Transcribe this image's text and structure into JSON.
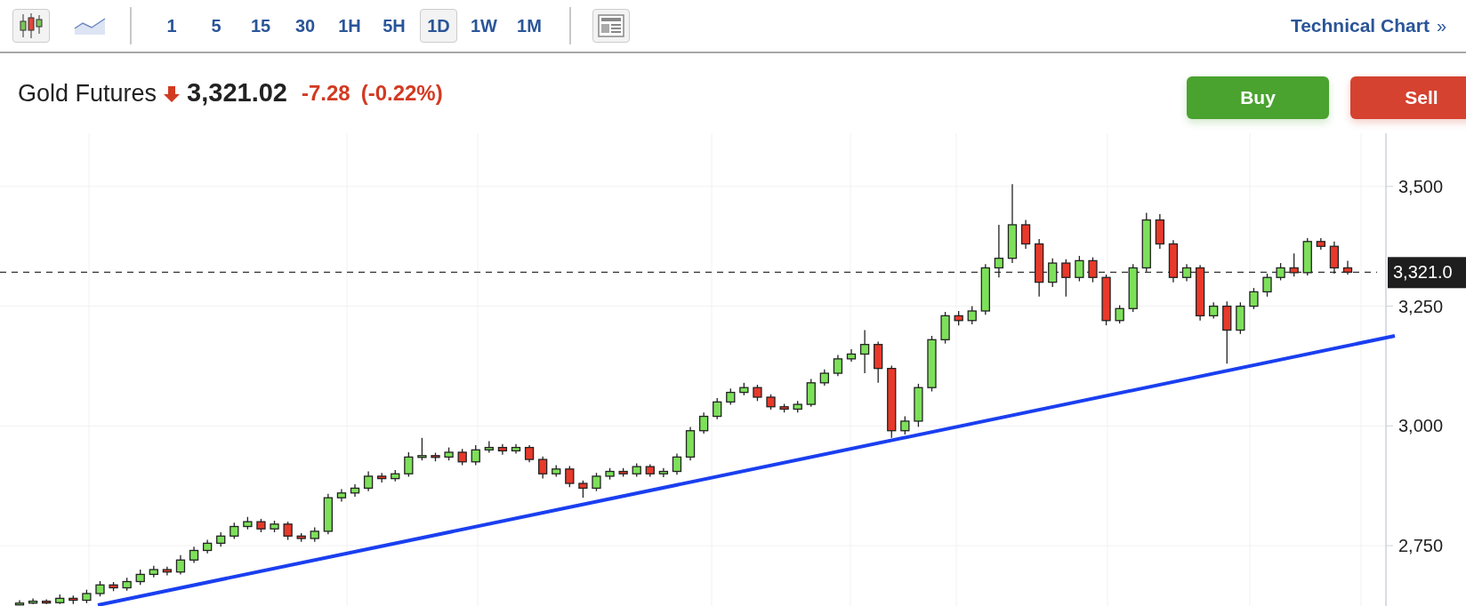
{
  "toolbar": {
    "chart_types": [
      {
        "kind": "candlestick",
        "selected": true
      },
      {
        "kind": "line",
        "selected": false
      }
    ],
    "intervals": [
      {
        "label": "1",
        "selected": false
      },
      {
        "label": "5",
        "selected": false
      },
      {
        "label": "15",
        "selected": false
      },
      {
        "label": "30",
        "selected": false
      },
      {
        "label": "1H",
        "selected": false
      },
      {
        "label": "5H",
        "selected": false
      },
      {
        "label": "1D",
        "selected": true
      },
      {
        "label": "1W",
        "selected": false
      },
      {
        "label": "1M",
        "selected": false
      }
    ],
    "technical_chart_link": "Technical Chart",
    "link_arrow": "»"
  },
  "quote": {
    "name": "Gold Futures",
    "falling": true,
    "price": "3,321.02",
    "change": "-7.28",
    "change_percent": "(-0.22%)"
  },
  "actions": [
    {
      "kind": "buy",
      "label": "Buy"
    },
    {
      "kind": "sell",
      "label": "Sell"
    }
  ],
  "chart": {
    "chart_data": {
      "type": "candlestick",
      "grid": true,
      "ylim": [
        2624,
        3611
      ],
      "ref_lines": [
        {
          "axis": "y",
          "value": 3321.02,
          "label": "3,321.0"
        }
      ],
      "yticks": [
        {
          "value": 3500,
          "label": "3,500"
        },
        {
          "value": 3250,
          "label": "3,250"
        },
        {
          "value": 3000,
          "label": "3,000"
        },
        {
          "value": 2750,
          "label": "2,750"
        }
      ],
      "ohlc": [
        [
          2628,
          2636,
          2627,
          2630
        ],
        [
          2630,
          2640,
          2628,
          2634
        ],
        [
          2634,
          2638,
          2628,
          2631
        ],
        [
          2631,
          2648,
          2628,
          2640
        ],
        [
          2640,
          2646,
          2628,
          2636
        ],
        [
          2636,
          2658,
          2630,
          2650
        ],
        [
          2650,
          2676,
          2644,
          2668
        ],
        [
          2668,
          2674,
          2655,
          2662
        ],
        [
          2662,
          2683,
          2656,
          2675
        ],
        [
          2675,
          2700,
          2668,
          2690
        ],
        [
          2690,
          2708,
          2684,
          2700
        ],
        [
          2700,
          2706,
          2688,
          2695
        ],
        [
          2695,
          2730,
          2690,
          2720
        ],
        [
          2720,
          2748,
          2714,
          2740
        ],
        [
          2740,
          2762,
          2734,
          2755
        ],
        [
          2755,
          2778,
          2748,
          2770
        ],
        [
          2770,
          2798,
          2764,
          2790
        ],
        [
          2790,
          2810,
          2784,
          2800
        ],
        [
          2800,
          2806,
          2778,
          2785
        ],
        [
          2785,
          2802,
          2778,
          2795
        ],
        [
          2795,
          2800,
          2762,
          2770
        ],
        [
          2770,
          2776,
          2758,
          2765
        ],
        [
          2765,
          2788,
          2758,
          2780
        ],
        [
          2780,
          2858,
          2774,
          2850
        ],
        [
          2850,
          2868,
          2842,
          2860
        ],
        [
          2860,
          2878,
          2852,
          2870
        ],
        [
          2870,
          2905,
          2864,
          2895
        ],
        [
          2895,
          2902,
          2882,
          2890
        ],
        [
          2890,
          2908,
          2884,
          2900
        ],
        [
          2900,
          2945,
          2894,
          2935
        ],
        [
          2935,
          2975,
          2928,
          2938
        ],
        [
          2938,
          2944,
          2926,
          2935
        ],
        [
          2935,
          2955,
          2928,
          2945
        ],
        [
          2945,
          2952,
          2918,
          2925
        ],
        [
          2925,
          2960,
          2918,
          2950
        ],
        [
          2950,
          2968,
          2944,
          2955
        ],
        [
          2955,
          2962,
          2940,
          2948
        ],
        [
          2948,
          2962,
          2942,
          2955
        ],
        [
          2955,
          2960,
          2924,
          2930
        ],
        [
          2930,
          2936,
          2890,
          2900
        ],
        [
          2900,
          2918,
          2894,
          2910
        ],
        [
          2910,
          2916,
          2872,
          2880
        ],
        [
          2880,
          2886,
          2850,
          2870
        ],
        [
          2870,
          2902,
          2864,
          2895
        ],
        [
          2895,
          2912,
          2888,
          2905
        ],
        [
          2905,
          2912,
          2894,
          2900
        ],
        [
          2900,
          2922,
          2894,
          2915
        ],
        [
          2915,
          2920,
          2894,
          2900
        ],
        [
          2900,
          2912,
          2893,
          2905
        ],
        [
          2905,
          2942,
          2898,
          2935
        ],
        [
          2935,
          2998,
          2928,
          2990
        ],
        [
          2990,
          3028,
          2984,
          3020
        ],
        [
          3020,
          3058,
          3014,
          3050
        ],
        [
          3050,
          3078,
          3044,
          3070
        ],
        [
          3070,
          3090,
          3064,
          3080
        ],
        [
          3080,
          3086,
          3052,
          3060
        ],
        [
          3060,
          3066,
          3034,
          3040
        ],
        [
          3040,
          3046,
          3028,
          3035
        ],
        [
          3035,
          3052,
          3028,
          3045
        ],
        [
          3045,
          3098,
          3040,
          3090
        ],
        [
          3090,
          3118,
          3084,
          3110
        ],
        [
          3110,
          3148,
          3104,
          3140
        ],
        [
          3140,
          3160,
          3134,
          3150
        ],
        [
          3150,
          3200,
          3110,
          3170
        ],
        [
          3170,
          3176,
          3090,
          3120
        ],
        [
          3120,
          3126,
          2975,
          2990
        ],
        [
          2990,
          3020,
          2982,
          3010
        ],
        [
          3010,
          3088,
          2998,
          3080
        ],
        [
          3080,
          3188,
          3072,
          3180
        ],
        [
          3180,
          3238,
          3172,
          3230
        ],
        [
          3230,
          3240,
          3210,
          3220
        ],
        [
          3220,
          3250,
          3212,
          3240
        ],
        [
          3240,
          3338,
          3232,
          3330
        ],
        [
          3330,
          3420,
          3310,
          3350
        ],
        [
          3350,
          3505,
          3340,
          3420
        ],
        [
          3420,
          3430,
          3370,
          3380
        ],
        [
          3380,
          3390,
          3270,
          3300
        ],
        [
          3300,
          3350,
          3290,
          3340
        ],
        [
          3340,
          3348,
          3270,
          3310
        ],
        [
          3310,
          3355,
          3302,
          3345
        ],
        [
          3345,
          3352,
          3300,
          3310
        ],
        [
          3310,
          3316,
          3210,
          3220
        ],
        [
          3220,
          3252,
          3214,
          3245
        ],
        [
          3245,
          3338,
          3238,
          3330
        ],
        [
          3330,
          3445,
          3322,
          3430
        ],
        [
          3430,
          3442,
          3370,
          3380
        ],
        [
          3380,
          3388,
          3300,
          3310
        ],
        [
          3310,
          3338,
          3302,
          3330
        ],
        [
          3330,
          3336,
          3220,
          3230
        ],
        [
          3230,
          3258,
          3224,
          3250
        ],
        [
          3250,
          3260,
          3130,
          3200
        ],
        [
          3200,
          3258,
          3192,
          3250
        ],
        [
          3250,
          3288,
          3244,
          3280
        ],
        [
          3280,
          3318,
          3270,
          3310
        ],
        [
          3310,
          3340,
          3304,
          3330
        ],
        [
          3330,
          3360,
          3312,
          3320
        ],
        [
          3320,
          3392,
          3314,
          3385
        ],
        [
          3385,
          3392,
          3368,
          3375
        ],
        [
          3375,
          3385,
          3318,
          3330
        ],
        [
          3330,
          3345,
          3316,
          3321
        ]
      ]
    }
  }
}
